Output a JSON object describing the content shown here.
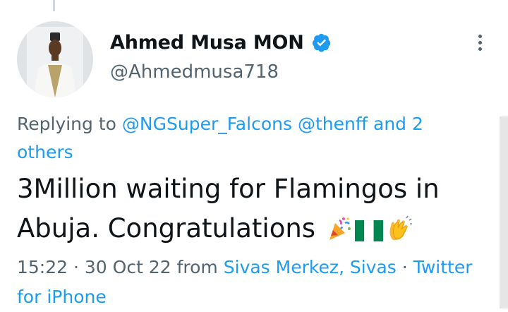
{
  "tweet": {
    "author": {
      "display_name": "Ahmed Musa MON",
      "handle": "@Ahmedmusa718",
      "verified": true
    },
    "reply_context": {
      "prefix": "Replying to",
      "mentions": [
        "@NGSuper_Falcons",
        "@thenff"
      ],
      "connector": "and",
      "others": "2 others"
    },
    "text": "3Million waiting for Flamingos in Abuja. Congratulations",
    "emojis": [
      "party-popper-icon",
      "nigeria-flag-icon",
      "clapping-hands-icon"
    ],
    "meta": {
      "time": "15:22",
      "separator": "·",
      "date": "30 Oct 22",
      "from_label": "from",
      "location": "Sivas Merkez, Sivas",
      "source": "Twitter for iPhone"
    }
  },
  "colors": {
    "accent": "#1d9bf0",
    "text_primary": "#0f1419",
    "text_secondary": "#536471",
    "flag_green": "#008751"
  }
}
